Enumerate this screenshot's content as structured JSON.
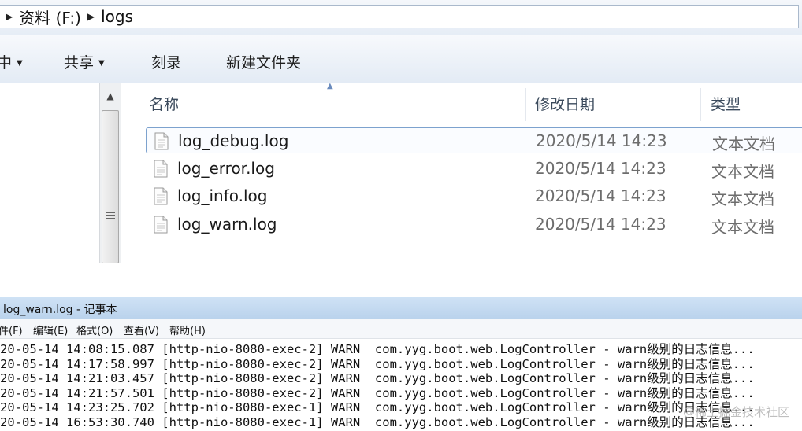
{
  "explorer": {
    "breadcrumb": [
      "资料 (F:)",
      "logs"
    ],
    "toolbar": {
      "organize_partial": "中",
      "share": "共享",
      "burn": "刻录",
      "new_folder": "新建文件夹"
    },
    "columns": {
      "name": "名称",
      "date": "修改日期",
      "type": "类型"
    },
    "files": [
      {
        "name": "log_debug.log",
        "date": "2020/5/14 14:23",
        "type": "文本文档",
        "selected": true
      },
      {
        "name": "log_error.log",
        "date": "2020/5/14 14:23",
        "type": "文本文档",
        "selected": false
      },
      {
        "name": "log_info.log",
        "date": "2020/5/14 14:23",
        "type": "文本文档",
        "selected": false
      },
      {
        "name": "log_warn.log",
        "date": "2020/5/14 14:23",
        "type": "文本文档",
        "selected": false
      }
    ]
  },
  "notepad": {
    "title": "log_warn.log - 记事本",
    "menu": [
      "件(F)",
      "编辑(E)",
      "格式(O)",
      "查看(V)",
      "帮助(H)"
    ],
    "lines": [
      "20-05-14 14:08:15.087 [http-nio-8080-exec-2] WARN  com.yyg.boot.web.LogController - warn级别的日志信息...",
      "20-05-14 14:17:58.997 [http-nio-8080-exec-2] WARN  com.yyg.boot.web.LogController - warn级别的日志信息...",
      "20-05-14 14:21:03.457 [http-nio-8080-exec-2] WARN  com.yyg.boot.web.LogController - warn级别的日志信息...",
      "20-05-14 14:21:57.501 [http-nio-8080-exec-2] WARN  com.yyg.boot.web.LogController - warn级别的日志信息...",
      "20-05-14 14:23:25.702 [http-nio-8080-exec-1] WARN  com.yyg.boot.web.LogController - warn级别的日志信息...",
      "20-05-14 16:53:30.740 [http-nio-8080-exec-1] WARN  com.yyg.boot.web.LogController - warn级别的日志信息..."
    ]
  },
  "watermark": "@稀土掘金技术社区",
  "icons": {
    "breadcrumb_separator": "triangle-right-icon",
    "file": "text-document-icon",
    "dropdown": "caret-down-icon",
    "sort": "sort-ascending-icon"
  },
  "colors": {
    "selection_border": "#7da2ce",
    "titlebar": "#c4daf0"
  }
}
